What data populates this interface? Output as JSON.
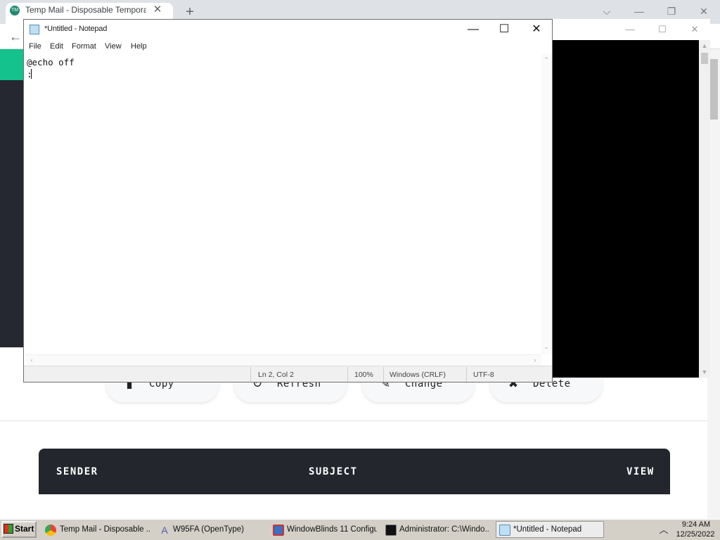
{
  "chrome": {
    "tab_title": "Temp Mail - Disposable Temporary Email",
    "tab_close": "✕",
    "new_tab": "+",
    "back": "←",
    "controls": {
      "dropdown": "⌵",
      "minimize": "—",
      "restore": "❐",
      "close": "✕"
    }
  },
  "site": {
    "buttons": [
      {
        "icon": "▮",
        "label": "Copy"
      },
      {
        "icon": "↻",
        "label": "Refresh"
      },
      {
        "icon": "✎",
        "label": "Change"
      },
      {
        "icon": "✖",
        "label": "Delete"
      }
    ],
    "inbox": {
      "sender": "SENDER",
      "subject": "SUBJECT",
      "view": "VIEW"
    }
  },
  "console": {
    "controls": {
      "minimize": "—",
      "maximize": "☐",
      "close": "✕"
    }
  },
  "notepad": {
    "title": "*Untitled - Notepad",
    "controls": {
      "minimize": "—",
      "maximize": "☐",
      "close": "✕"
    },
    "menu": [
      "File",
      "Edit",
      "Format",
      "View",
      "Help"
    ],
    "text": "@echo off\n:",
    "status": {
      "position": "Ln 2, Col 2",
      "zoom": "100%",
      "line_endings": "Windows (CRLF)",
      "encoding": "UTF-8"
    }
  },
  "taskbar": {
    "start_label": "Start",
    "items": [
      {
        "label": "Temp Mail - Disposable ...",
        "icon": "chrome-icon"
      },
      {
        "label": "W95FA (OpenType)",
        "icon": "font-icon"
      },
      {
        "label": "WindowBlinds 11 Configu...",
        "icon": "windowblinds-icon"
      },
      {
        "label": "Administrator: C:\\Windo...",
        "icon": "console-icon"
      },
      {
        "label": "*Untitled - Notepad",
        "icon": "notepad-icon"
      }
    ],
    "tray_chevron": "︿",
    "time": "9:24 AM",
    "date": "12/25/2022"
  }
}
